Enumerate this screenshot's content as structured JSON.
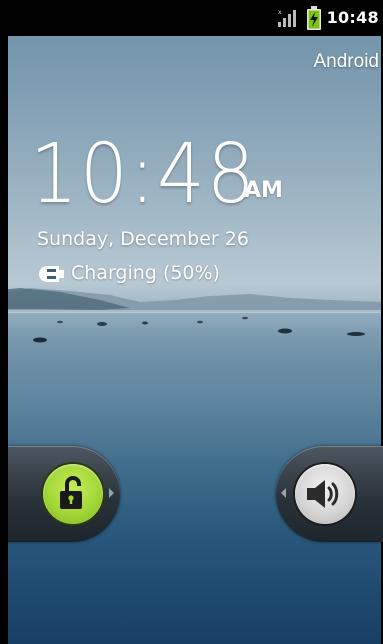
{
  "status_bar": {
    "time": "10:48",
    "signal_icon": "signal-bars-icon",
    "battery_icon": "battery-charging-icon"
  },
  "lock_screen": {
    "carrier": "Android",
    "clock": {
      "time": "10:48",
      "ampm": "AM"
    },
    "date": "Sunday, December 26",
    "charging": {
      "icon": "plug-icon",
      "text": "Charging (50%)",
      "level_percent": 50
    },
    "unlock_tab": {
      "icon": "unlock-padlock-icon",
      "color": "#a7d93a"
    },
    "sound_tab": {
      "icon": "speaker-icon"
    }
  }
}
